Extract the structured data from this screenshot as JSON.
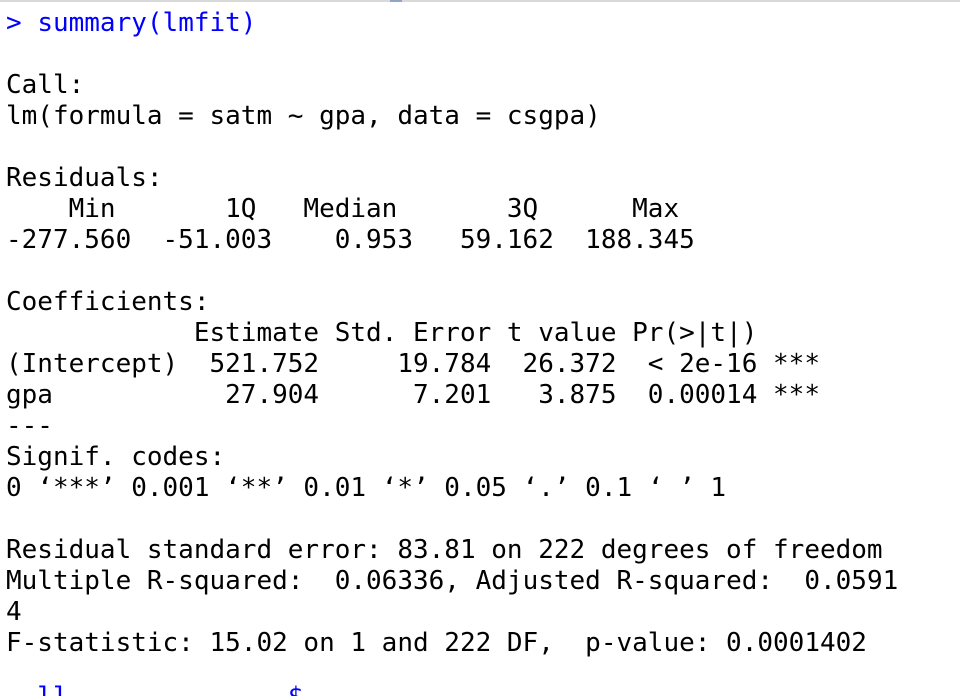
{
  "console": {
    "prompt": ">",
    "command": "summary(lmfit)",
    "output_lines": [
      "",
      "Call:",
      "lm(formula = satm ~ gpa, data = csgpa)",
      "",
      "Residuals:",
      "    Min       1Q   Median       3Q      Max ",
      "-277.560  -51.003    0.953   59.162  188.345 ",
      "",
      "Coefficients:",
      "            Estimate Std. Error t value Pr(>|t|)    ",
      "(Intercept)  521.752     19.784  26.372  < 2e-16 ***",
      "gpa           27.904      7.201   3.875  0.00014 ***",
      "---",
      "Signif. codes:  ",
      "0 ‘***’ 0.001 ‘**’ 0.01 ‘*’ 0.05 ‘.’ 0.1 ‘ ’ 1",
      "",
      "Residual standard error: 83.81 on 222 degrees of freedom",
      "Multiple R-squared:  0.06336,\tAdjusted R-squared:  0.0591",
      "4 ",
      "F-statistic: 15.02 on 1 and 222 DF,  p-value: 0.0001402",
      ""
    ],
    "partial_next_line": "  ll              $"
  }
}
